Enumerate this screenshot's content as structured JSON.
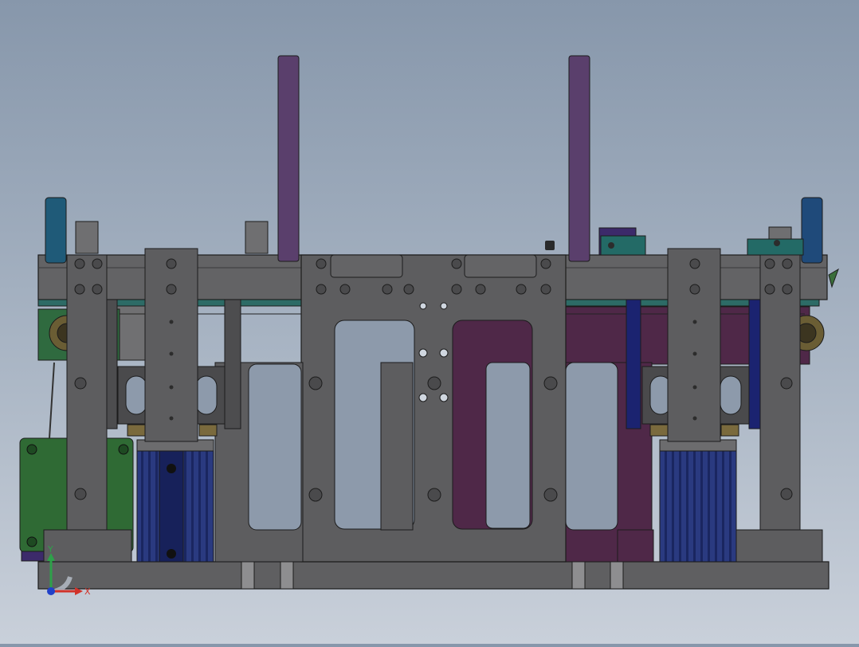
{
  "viewport": {
    "background_top": "#8797ab",
    "background_bottom": "#c9d0da"
  },
  "colors": {
    "steel": "#5d5d5f",
    "steel_dark": "#4a4a4c",
    "edge": "#1c1c1c",
    "purple": "#4f2848",
    "plum": "#3f3560",
    "rod": "#5a3f6c",
    "blue": "#283a7a",
    "navy": "#111a5e",
    "teal": "#1f5f6e",
    "green": "#2f6a34",
    "tan": "#7a6a3d"
  },
  "triad": {
    "x_label": "X",
    "y_label": "Y",
    "x_color": "#d1332a",
    "y_color": "#2ea14a",
    "z_color": "#2141c9"
  }
}
